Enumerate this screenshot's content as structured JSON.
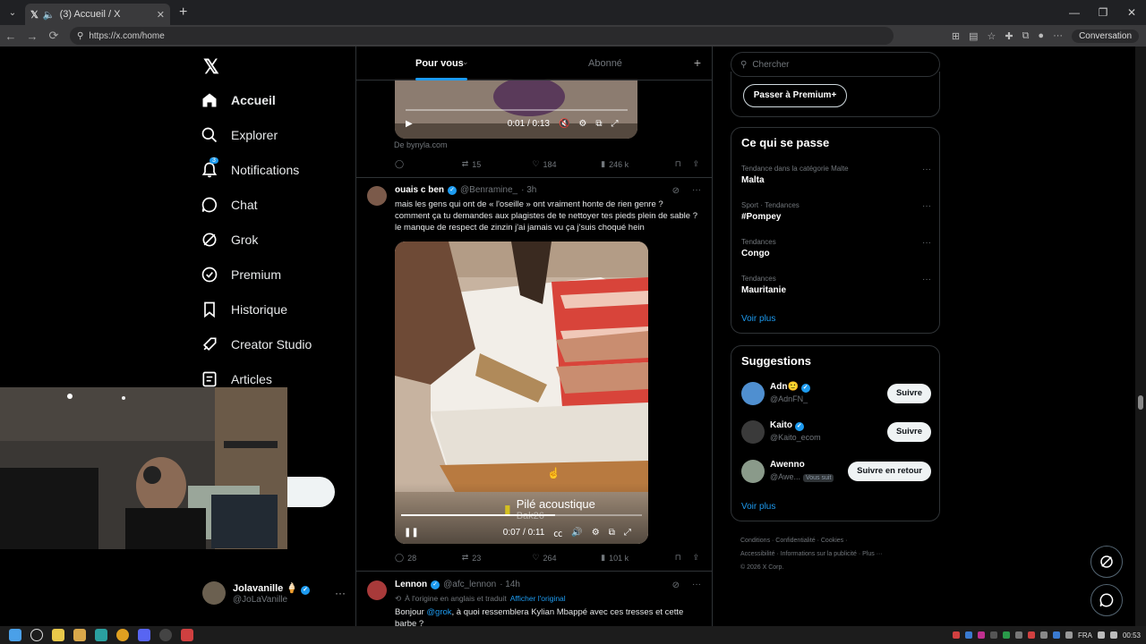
{
  "browser": {
    "tab_title": "(3) Accueil / X",
    "url": "https://x.com/home",
    "conversation_label": "Conversation"
  },
  "nav": {
    "items": [
      {
        "label": "Accueil",
        "icon": "home-icon"
      },
      {
        "label": "Explorer",
        "icon": "search-icon"
      },
      {
        "label": "Notifications",
        "icon": "bell-icon"
      },
      {
        "label": "Chat",
        "icon": "chat-icon"
      },
      {
        "label": "Grok",
        "icon": "grok-icon"
      },
      {
        "label": "Premium",
        "icon": "premium-icon"
      },
      {
        "label": "Historique",
        "icon": "bookmark-icon"
      },
      {
        "label": "Creator Studio",
        "icon": "rocket-icon"
      },
      {
        "label": "Articles",
        "icon": "article-icon"
      }
    ],
    "notification_count": "3"
  },
  "account": {
    "name": "Jolavanille 🍦",
    "handle": "@JoLaVanille"
  },
  "feed": {
    "tabs": [
      "Pour vous",
      "Abonné"
    ],
    "post1": {
      "video_time": "0:01 / 0:13",
      "source": "De bynyla.com",
      "replies": "",
      "reposts": "15",
      "likes": "184",
      "views": "246 k"
    },
    "post2": {
      "name": "ouais c ben",
      "handle": "@Benramine_",
      "time": "· 3h",
      "text": "mais les gens qui ont de « l'oseille » ont vraiment honte de rien genre ? comment ça tu demandes aux plagistes de te nettoyer tes pieds plein de sable ? le manque de respect de zinzin j'ai jamais vu ça j'suis choqué hein",
      "video_time": "0:07 / 0:11",
      "overlay_title": "Pilé acoustique",
      "overlay_sub": "Bak26",
      "replies": "28",
      "reposts": "23",
      "likes": "264",
      "views": "101 k"
    },
    "post3": {
      "name": "Lennon",
      "handle": "@afc_lennon",
      "time": "· 14h",
      "translated_note": "À l'origine en anglais et traduit",
      "show_original": "Afficher l'original",
      "text_prefix": "Bonjour ",
      "mention": "@grok",
      "text_suffix": ", à quoi ressemblera Kylian Mbappé avec ces tresses et cette barbe ?"
    }
  },
  "sidebar": {
    "search_placeholder": "Chercher",
    "premium_button": "Passer à Premium+",
    "trends_title": "Ce qui se passe",
    "trends": [
      {
        "meta": "Tendance dans la catégorie Malte",
        "title": "Malta"
      },
      {
        "meta": "Sport · Tendances",
        "title": "#Pompey"
      },
      {
        "meta": "Tendances",
        "title": "Congo"
      },
      {
        "meta": "Tendances",
        "title": "Mauritanie"
      }
    ],
    "see_more": "Voir plus",
    "suggestions_title": "Suggestions",
    "suggestions": [
      {
        "name": "Adn🙂",
        "handle": "@AdnFN_",
        "button": "Suivre"
      },
      {
        "name": "Kaito",
        "handle": "@Kaito_ecom",
        "button": "Suivre"
      },
      {
        "name": "Awenno",
        "handle": "@Awe...",
        "badge": "Vous suit",
        "button": "Suivre en retour"
      }
    ],
    "see_more2": "Voir plus",
    "footer_line1": "Conditions · Confidentialité · Cookies ·",
    "footer_line2": "Accessibilité · Informations sur la publicité · Plus ···",
    "footer_line3": "© 2026 X Corp."
  },
  "taskbar": {
    "lang": "FRA",
    "clock": "00:53"
  }
}
